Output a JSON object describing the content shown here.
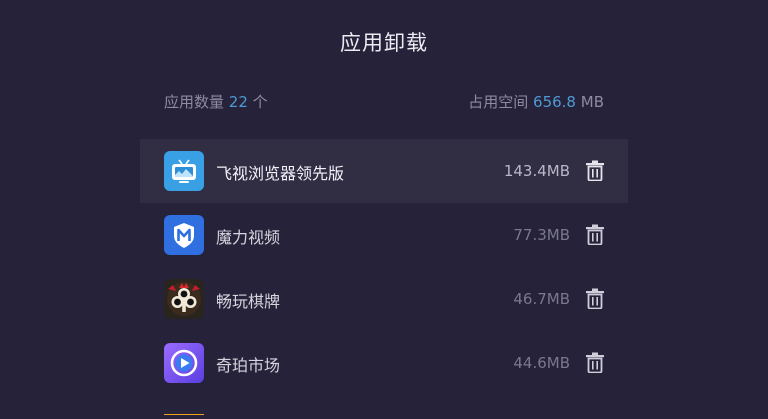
{
  "header": {
    "title": "应用卸载"
  },
  "summary": {
    "count_label": "应用数量",
    "count_value": "22",
    "count_unit": "个",
    "space_label": "占用空间",
    "space_value": "656.8",
    "space_unit": "MB"
  },
  "apps": [
    {
      "name": "飞视浏览器领先版",
      "size": "143.4MB",
      "icon": "tv-browser-icon",
      "focused": true
    },
    {
      "name": "魔力视频",
      "size": "77.3MB",
      "icon": "m-shield-icon",
      "focused": false
    },
    {
      "name": "畅玩棋牌",
      "size": "46.7MB",
      "icon": "card-club-icon",
      "focused": false
    },
    {
      "name": "奇珀市场",
      "size": "44.6MB",
      "icon": "play-market-icon",
      "focused": false
    }
  ],
  "colors": {
    "background": "#25223a",
    "row_focus": "#312e44",
    "accent": "#4f9ad4"
  }
}
